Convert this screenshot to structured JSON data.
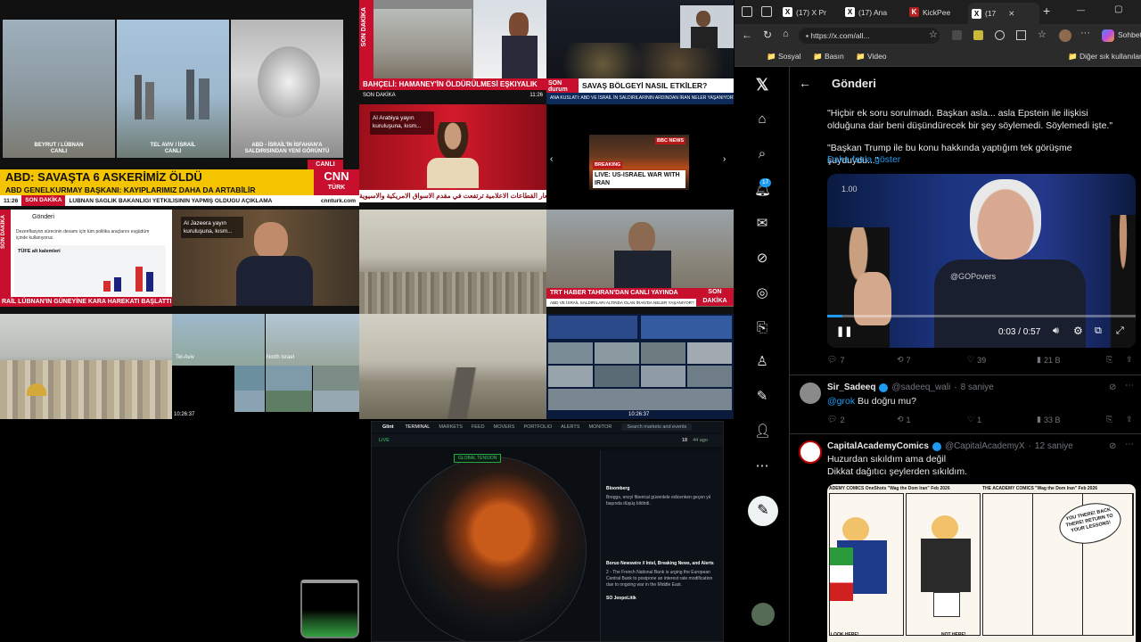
{
  "tv": {
    "cnn_cap1": "BEYRUT / LÜBNAN\nCANLI",
    "cnn_cap2": "TEL AVIV / İSRAİL\nCANLI",
    "cnn_cap3": "ABD - İSRAİL'İN İSFAHAN'A\nSALDIRISINDAN YENİ GÖRÜNTÜ",
    "cnn_live": "CANLI",
    "cnn_headline": "ABD: SAVAŞTA 6 ASKERİMİZ ÖLDÜ",
    "cnn_sub": "ABD GENELKURMAY BAŞKANI: KAYIPLARIMIZ DAHA DA ARTABİLİR",
    "cnn_time": "11:26",
    "cnn_flash": "SON DAKİKA",
    "cnn_ticker": "LÜBNAN SAĞLIK BAKANLIĞI YETKİLİSİNİN YAPMIŞ OLDUĞU AÇIKLAMA",
    "cnn_site": "cnnturk.com",
    "cnn_logo1": "CNN",
    "cnn_logo2": "TÜRK",
    "ntv_side": "SON DAKİKA",
    "ntv_headline": "BAHÇELİ: HAMANEY'İN ÖLDÜRÜLMESİ EŞKIYALIK",
    "ntv_flash": "SON DAKİKA",
    "ntv_time": "11:26",
    "son_durum": "SON durum",
    "savas_headline": "SAVAŞ BÖLGEYİ NASIL ETKİLER?",
    "savas_ticker": "ANA KUSLATI: ABD VE İSRAİL İN SALDIRILARININ ARDINDAN İRAN NELER YAŞANIYOR?",
    "aljazeera_arabic": "Al Arabiya yayın kuruluşuna, kısm...",
    "arab_headline": "اسعار القطاعات الاعلامية ترتفعت في مقدم الاسواق الامريكية والاسيوية",
    "bbc_logo": "BBC NEWS",
    "bbc_breaking": "BREAKING",
    "bbc_headline": "LIVE: US-ISRAEL WAR WITH IRAN",
    "bbg_side": "SON DAKİKA",
    "bbg_header": "Gönderi",
    "bbg_text": "Dezenflasyon sürecinin devamı için tüm politika araçlarını esgüdüm içinde kullanıyoruz.",
    "bbg_panel": "TÜFE alt kalemleri",
    "bbg_ticker": "RAİL LÜBNAN'IN GÜNEYİNE KARA HAREKATI BAŞLATTI",
    "aljazeera_cap": "Al Jazeera yayın kuruluşuna, kısm...",
    "trt_headline": "TRT HABER TAHRAN'DAN CANLI YAYINDA",
    "trt_sub": "ABD VE İSRAİL SALDIRILARI ALTINDA OLAN İRAN'DA NELER YAŞANIYOR?",
    "trt_badge": "SON DAKİKA",
    "cam_tel_aviv": "Tel-Aviv",
    "cam_north": "North Israel",
    "cam_time1": "10:26:37",
    "cam_time2": "10:26:37"
  },
  "glint": {
    "logo": "Glint",
    "nav": [
      "TERMINAL",
      "MARKETS",
      "FEED",
      "MOVERS",
      "PORTFOLIO",
      "ALERTS",
      "MONITOR"
    ],
    "search": "Search markets and events",
    "live": "LIVE",
    "globe_label": "GLOBAL TENSION",
    "posts": [
      {
        "source": "Bloomberg",
        "text": "Breggs, enzyl fiberical güvenlele edicenken geçen yıl başında düşüş bildirdi."
      },
      {
        "source": "Boruo Newswire // Intel, Breaking News, and Alerts",
        "text": "2 - The French National Bank is urging the European Central Bank to postpone an interest rate modification due to ongoing war in the Middle East."
      },
      {
        "source": "SO JeopoLitik",
        "text": ""
      }
    ],
    "counter": "18",
    "counter_label": "44 ago"
  },
  "browser": {
    "tabs": [
      {
        "label": "(17) X Pr",
        "icon": "x-icon"
      },
      {
        "label": "(17) Ana",
        "icon": "x-icon"
      },
      {
        "label": "KickPee",
        "icon": "kick-icon"
      },
      {
        "label": "(17",
        "icon": "x-icon"
      }
    ],
    "url": "https://x.com/all...",
    "profile_label": "Sohbet",
    "bookmarks": [
      "Sosyal",
      "Basın",
      "Video"
    ],
    "other_bookmarks": "Diğer sık kullanılan",
    "win_min": "—",
    "win_max": "▢"
  },
  "x": {
    "notif_count": "17",
    "header": "Gönderi",
    "post_text1": "\"Hiçbir ek soru sorulmadı. Başkan asla... asla Epstein ile ilişkisi olduğuna dair beni düşündürecek bir şey söylemedi. Söylemedi işte.\"",
    "post_text2": "\"Başkan Trump ile bu konu hakkında yaptığım tek görüşme şuyduydu...\"",
    "show_more": "Daha fazla göster",
    "video_speed": "1.00",
    "video_time": "0:03 / 0:57",
    "video_watermark": "@GOPovers",
    "video_progress": 0.05,
    "stats": {
      "replies": "7",
      "reposts": "7",
      "likes": "39",
      "views": "21 B"
    },
    "reply1": {
      "name": "Sir_Sadeeq",
      "handle": "@sadeeq_wali",
      "time": "8 saniye",
      "mention": "@grok",
      "text": " Bu doğru mu?",
      "replies": "2",
      "reposts": "1",
      "likes": "1",
      "views": "33 B"
    },
    "reply2": {
      "name": "CapitalAcademyComics",
      "handle": "@CapitalAcademyX",
      "time": "12 saniye",
      "line1": "Huzurdan sıkıldım ama değil",
      "line2": "Dikkat dağıtıcı şeylerden sıkıldım.",
      "comic_title1": "ADEMY COMICS OneShots \"Wag the Dom Iran\" Feb 2026",
      "comic_title2": "THE ACADEMY COMICS \"Wag the Dom Iran\" Feb 2026",
      "comic_b1": "YOU THERE! BACK THERE! RETURN TO YOUR LESSONS!",
      "comic_b2": "LOOK HERE!",
      "comic_b3": "NOT HERE!"
    }
  }
}
